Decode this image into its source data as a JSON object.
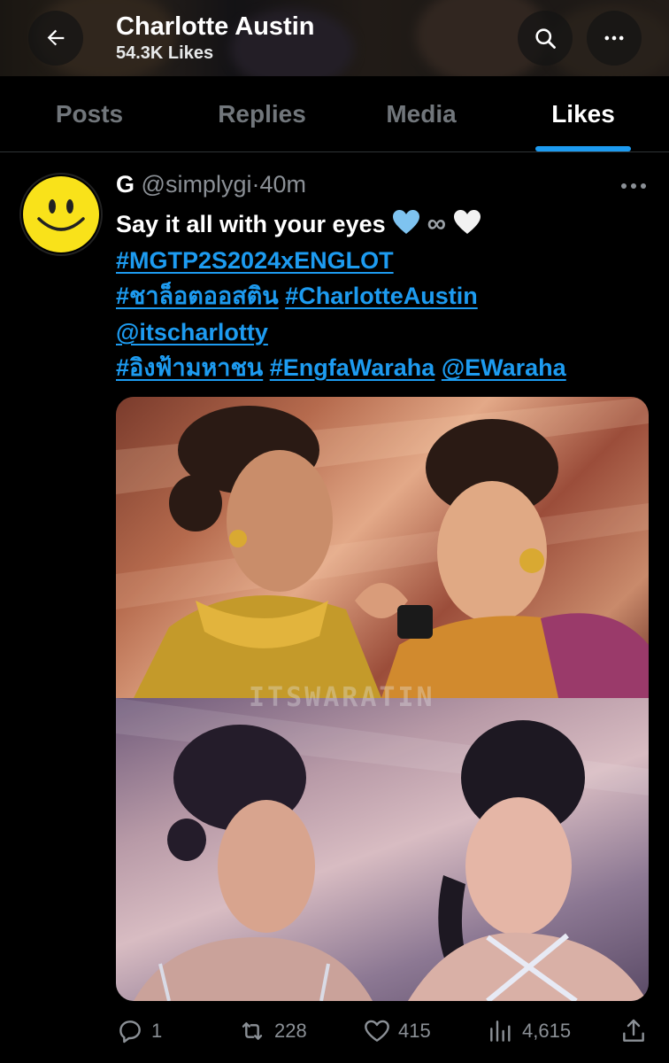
{
  "header": {
    "title": "Charlotte Austin",
    "subtitle": "54.3K Likes",
    "back_icon": "arrow-left-icon",
    "search_icon": "search-icon",
    "more_icon": "more-horizontal-icon"
  },
  "tabs": [
    {
      "label": "Posts",
      "active": false
    },
    {
      "label": "Replies",
      "active": false
    },
    {
      "label": "Media",
      "active": false
    },
    {
      "label": "Likes",
      "active": true
    }
  ],
  "tweet": {
    "name": "G",
    "handle": "@simplygi",
    "separator": "·",
    "time": "40m",
    "text_line1": "Say it all with your eyes",
    "infinity": "∞",
    "hashtag1": "#MGTP2S2024xENGLOT",
    "hashtag2": "#ชาล็อตออสติน",
    "hashtag3": "#CharlotteAustin",
    "mention1": "@itscharlotty",
    "hashtag4": "#อิงฟ้ามหาชน",
    "hashtag5": "#EngfaWaraha",
    "mention2": "@EWaraha",
    "watermark": "ITSWARATIN",
    "stats": {
      "replies": "1",
      "reposts": "228",
      "likes": "415",
      "views": "4,615"
    }
  },
  "colors": {
    "accent": "#1d9bf0",
    "muted": "#71767b",
    "background": "#000000"
  }
}
